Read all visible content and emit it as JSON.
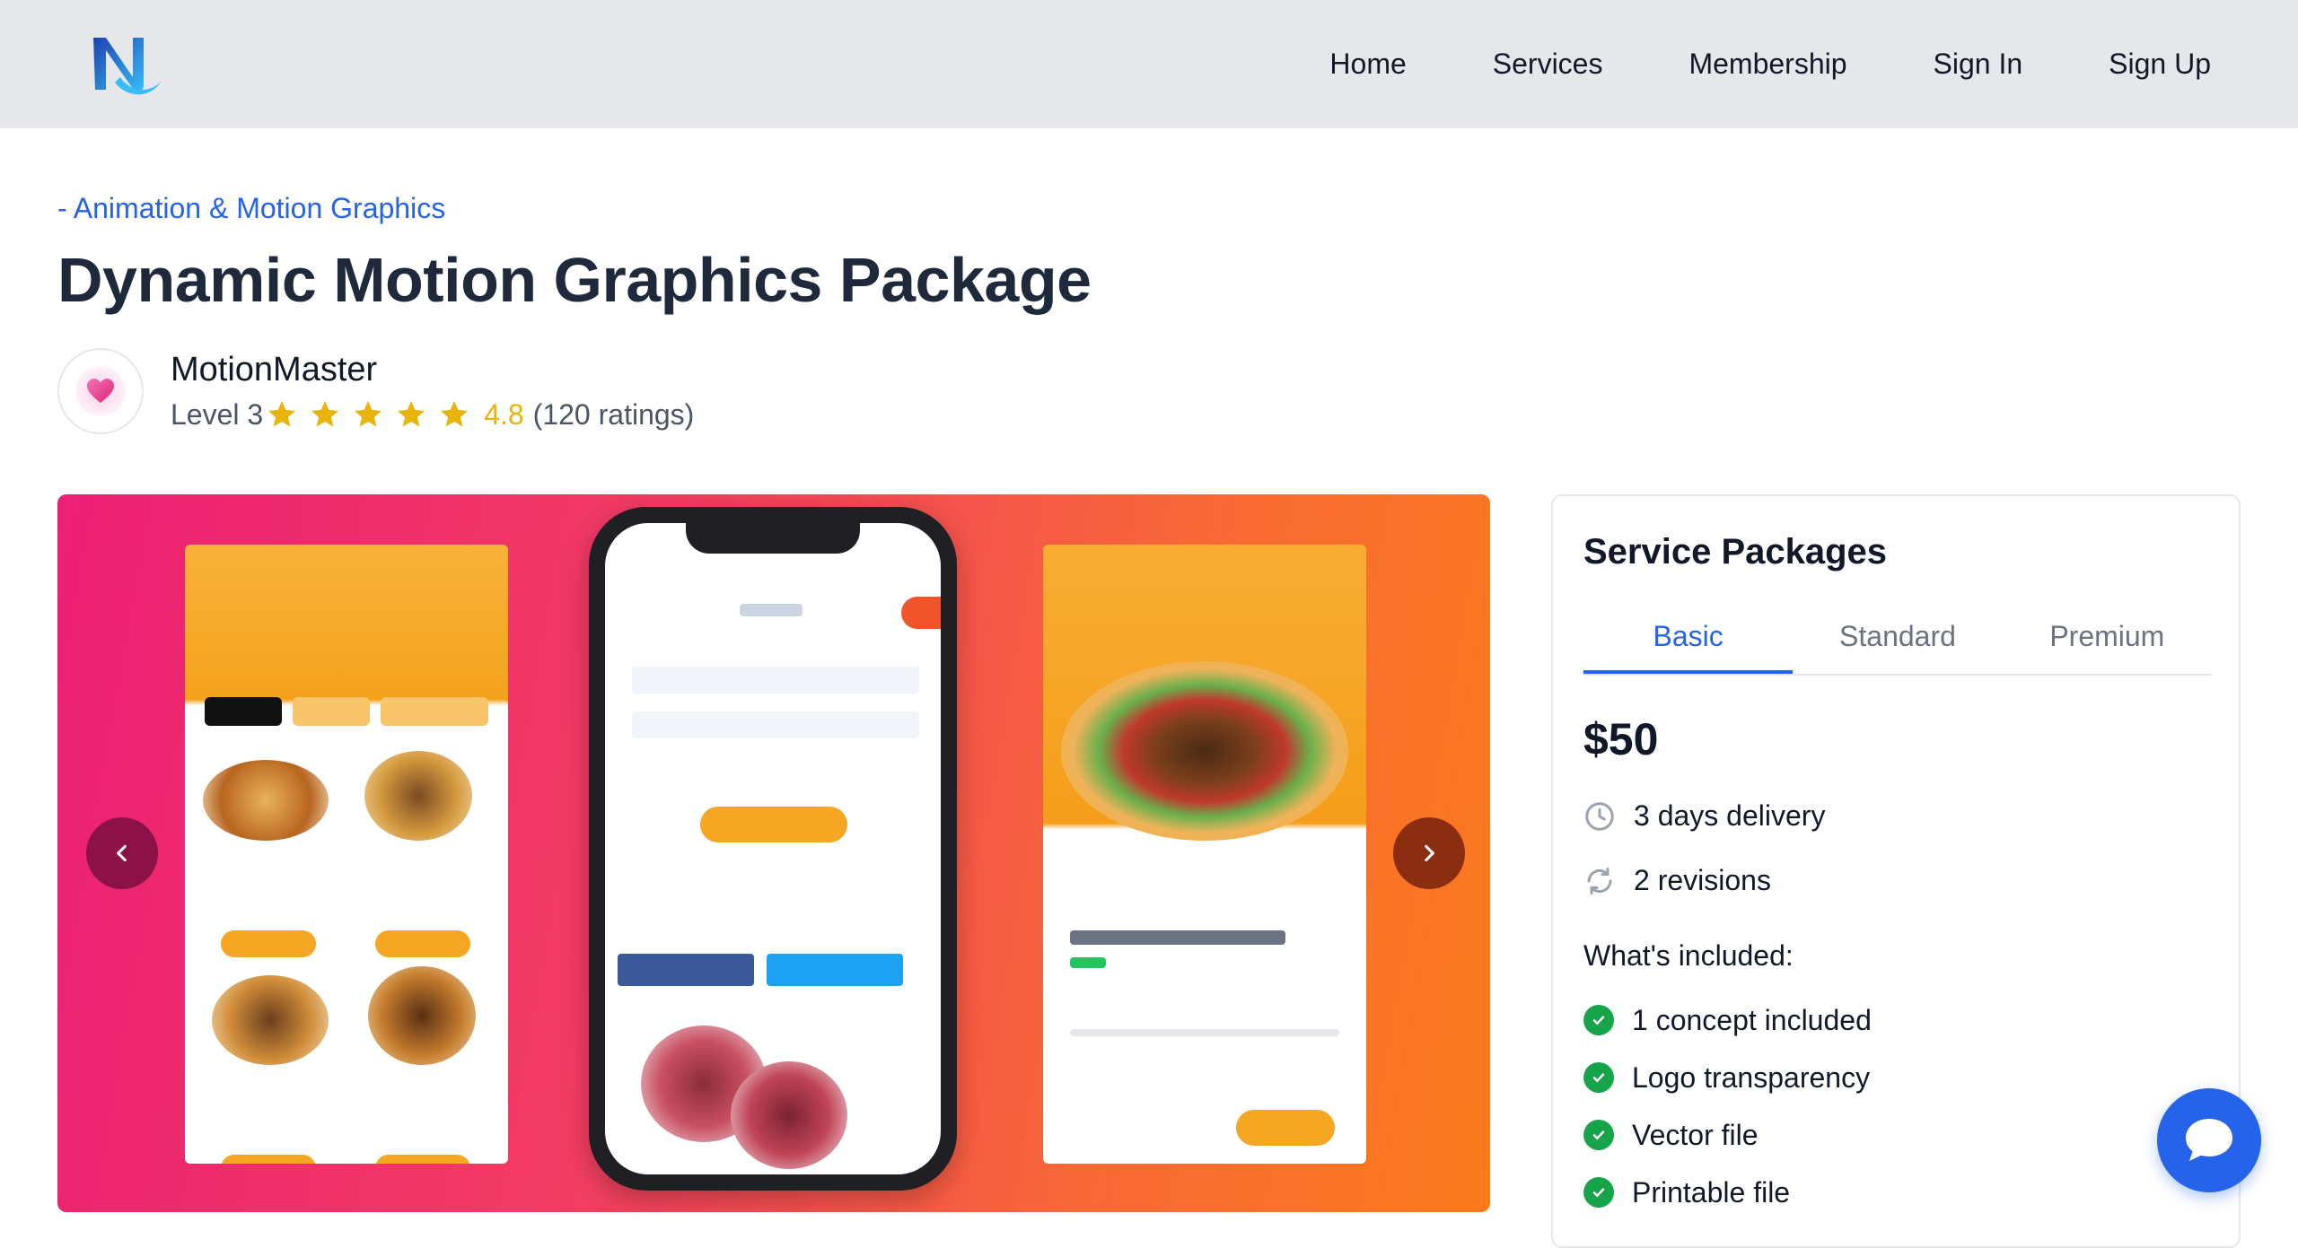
{
  "nav": {
    "items": [
      {
        "label": "Home"
      },
      {
        "label": "Services"
      },
      {
        "label": "Membership"
      },
      {
        "label": "Sign In"
      },
      {
        "label": "Sign Up"
      }
    ],
    "logo_icon": "n-logo-icon"
  },
  "breadcrumb": "- Animation & Motion Graphics",
  "title": "Dynamic Motion Graphics Package",
  "seller": {
    "name": "MotionMaster",
    "level": "Level 3",
    "stars": 5,
    "rating": "4.8",
    "ratings_count": "(120 ratings)",
    "avatar_icon": "heart-icon"
  },
  "gallery": {
    "prev_icon": "chevron-left-icon",
    "next_icon": "chevron-right-icon"
  },
  "packages": {
    "title": "Service Packages",
    "tabs": [
      {
        "label": "Basic",
        "active": true
      },
      {
        "label": "Standard",
        "active": false
      },
      {
        "label": "Premium",
        "active": false
      }
    ],
    "price": "$50",
    "delivery": "3 days delivery",
    "revisions": "2 revisions",
    "included_title": "What's included:",
    "included": [
      {
        "label": "1 concept included"
      },
      {
        "label": "Logo transparency"
      },
      {
        "label": "Vector file"
      },
      {
        "label": "Printable file"
      }
    ]
  },
  "chat_icon": "chat-bubble-icon",
  "colors": {
    "accent": "#2563eb",
    "star": "#eab308",
    "check": "#16a34a",
    "topbar": "#e5e7eb"
  }
}
